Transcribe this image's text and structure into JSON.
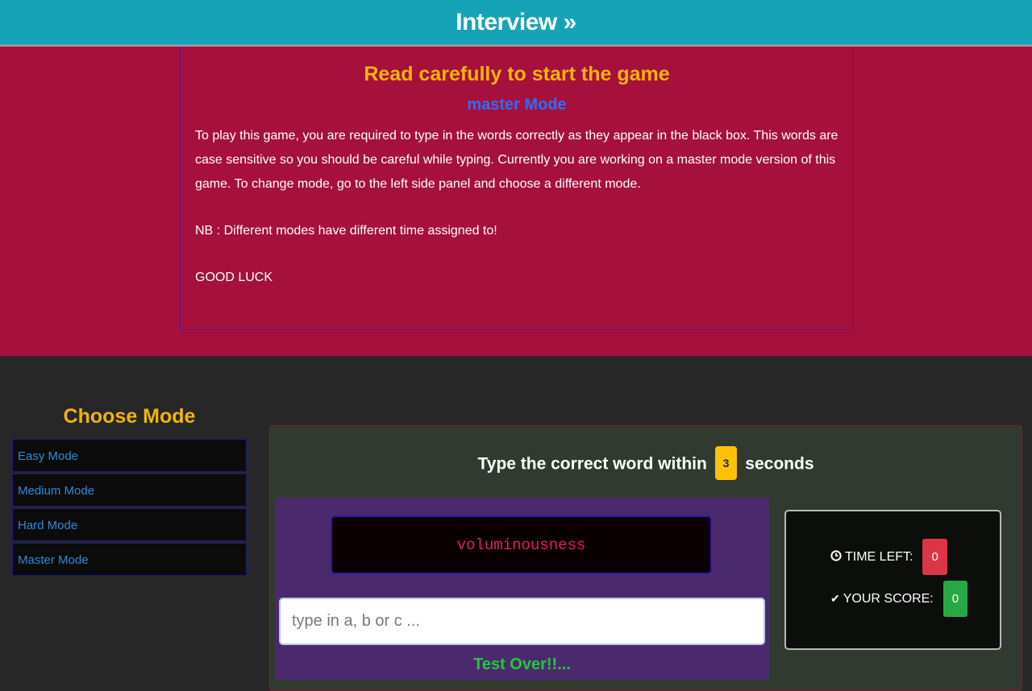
{
  "nav": {
    "brand": "Interview »"
  },
  "instructions": {
    "title": "Read carefully to start the game",
    "mode_label": "master Mode",
    "paragraphs": [
      "To play this game, you are required to type in the words correctly as they appear in the black box. This words are case sensitive so you should be careful while typing. Currently you are working on a master mode version of this game. To change mode, go to the left side panel and choose a different mode.",
      "NB : Different modes have different time assigned to!",
      "GOOD LUCK"
    ]
  },
  "sidebar": {
    "title": "Choose Mode",
    "modes": [
      {
        "label": "Easy Mode"
      },
      {
        "label": "Medium Mode"
      },
      {
        "label": "Hard Mode"
      },
      {
        "label": "Master Mode"
      }
    ]
  },
  "game": {
    "prompt_before": "Type the correct word within",
    "seconds": "3",
    "prompt_after": "seconds",
    "current_word": "voluminousness",
    "input_placeholder": "type in a, b or c ...",
    "input_value": "",
    "status": "Test Over!!...",
    "time_left_label": "TIME LEFT:",
    "time_left": "0",
    "score_label": "YOUR SCORE:",
    "score": "0"
  },
  "colors": {
    "header": "#16a3b8",
    "hero": "#a6103c",
    "accent_yellow": "#f2b40b",
    "mode_link": "#2a8cd9",
    "word_text": "#e0205e",
    "status_green": "#22c93a"
  }
}
